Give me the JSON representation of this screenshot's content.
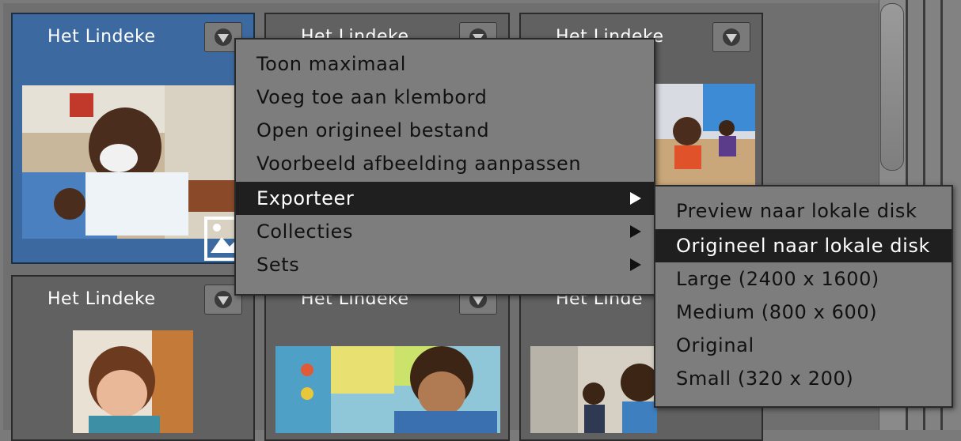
{
  "colors": {
    "selected_tile": "#3c6aa0",
    "tile_bg": "#616161",
    "menu_bg": "#7d7d7d",
    "menu_active_bg": "#1f1f1f"
  },
  "tiles": [
    {
      "title": "Het Lindeke",
      "selected": true
    },
    {
      "title": "Het Lindeke",
      "selected": false
    },
    {
      "title": "Het Lindeke",
      "selected": false
    },
    {
      "title": "Het Lindeke",
      "selected": false
    },
    {
      "title": "Het Lindeke",
      "selected": false
    },
    {
      "title": "Het Linde",
      "selected": false
    }
  ],
  "tile_menu_icon": "chevron-down-circle-icon",
  "context_menu": {
    "items": [
      {
        "label": "Toon maximaal",
        "has_submenu": false
      },
      {
        "label": "Voeg toe aan klembord",
        "has_submenu": false
      },
      {
        "label": "Open origineel bestand",
        "has_submenu": false
      },
      {
        "label": "Voorbeeld afbeelding aanpassen",
        "has_submenu": false
      },
      {
        "label": "Exporteer",
        "has_submenu": true,
        "active": true
      },
      {
        "label": "Collecties",
        "has_submenu": true
      },
      {
        "label": "Sets",
        "has_submenu": true
      }
    ]
  },
  "export_submenu": {
    "items": [
      {
        "label": "Preview naar lokale disk"
      },
      {
        "label": "Origineel naar lokale disk",
        "active": true
      },
      {
        "label": "Large (2400 x 1600)"
      },
      {
        "label": "Medium (800 x 600)"
      },
      {
        "label": "Original"
      },
      {
        "label": "Small (320 x 200)"
      }
    ]
  }
}
